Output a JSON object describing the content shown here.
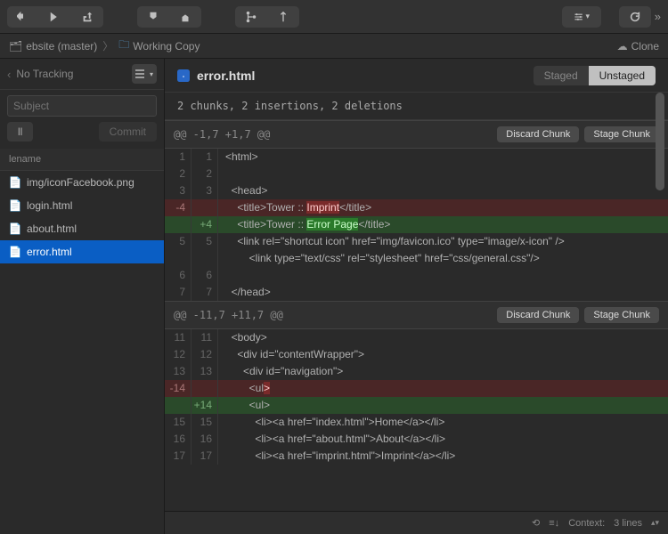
{
  "breadcrumb": {
    "repo": "ebsite (master)",
    "folder": "Working Copy"
  },
  "cloneLabel": "Clone",
  "sidebar": {
    "trackingLabel": "No Tracking",
    "subjectPlaceholder": "Subject",
    "allLabel": "ll",
    "commitLabel": "Commit",
    "columnHeader": "lename",
    "files": [
      {
        "name": "img/iconFacebook.png"
      },
      {
        "name": "login.html"
      },
      {
        "name": "about.html"
      },
      {
        "name": "error.html"
      }
    ]
  },
  "diff": {
    "filename": "error.html",
    "stagedLabel": "Staged",
    "unstagedLabel": "Unstaged",
    "summary": "2 chunks, 2 insertions, 2 deletions",
    "discardLabel": "Discard Chunk",
    "stageLabel": "Stage Chunk",
    "chunks": [
      {
        "range": "@@ -1,7 +1,7 @@",
        "lines": [
          {
            "old": "1",
            "new": "1",
            "type": "ctx",
            "text": "<html>"
          },
          {
            "old": "2",
            "new": "2",
            "type": "ctx",
            "text": ""
          },
          {
            "old": "3",
            "new": "3",
            "type": "ctx",
            "text": "  <head>"
          },
          {
            "old": "-4",
            "new": "",
            "type": "del",
            "prefix": "    <title>Tower :: ",
            "highlight": "Imprint",
            "suffix": "</title>"
          },
          {
            "old": "",
            "new": "+4",
            "type": "add",
            "prefix": "    <title>Tower :: ",
            "highlight": "Error Page",
            "suffix": "</title>"
          },
          {
            "old": "5",
            "new": "5",
            "type": "ctx",
            "text": "    <link rel=\"shortcut icon\" href=\"img/favicon.ico\" type=\"image/x-icon\" />"
          },
          {
            "old": "",
            "new": "",
            "type": "ctx",
            "text": "        <link type=\"text/css\" rel=\"stylesheet\" href=\"css/general.css\"/>"
          },
          {
            "old": "6",
            "new": "6",
            "type": "ctx",
            "text": ""
          },
          {
            "old": "7",
            "new": "7",
            "type": "ctx",
            "text": "  </head>"
          }
        ]
      },
      {
        "range": "@@ -11,7 +11,7 @@",
        "lines": [
          {
            "old": "11",
            "new": "11",
            "type": "ctx",
            "text": "  <body>"
          },
          {
            "old": "12",
            "new": "12",
            "type": "ctx",
            "text": "    <div id=\"contentWrapper\">"
          },
          {
            "old": "13",
            "new": "13",
            "type": "ctx",
            "text": "      <div id=\"navigation\">"
          },
          {
            "old": "-14",
            "new": "",
            "type": "del",
            "prefix": "        <ul",
            "highlight": ">",
            "suffix": ""
          },
          {
            "old": "",
            "new": "+14",
            "type": "add",
            "prefix": "        <ul>",
            "highlight": "",
            "suffix": ""
          },
          {
            "old": "15",
            "new": "15",
            "type": "ctx",
            "text": "          <li><a href=\"index.html\">Home</a></li>"
          },
          {
            "old": "16",
            "new": "16",
            "type": "ctx",
            "text": "          <li><a href=\"about.html\">About</a></li>"
          },
          {
            "old": "17",
            "new": "17",
            "type": "ctx",
            "text": "          <li><a href=\"imprint.html\">Imprint</a></li>"
          }
        ]
      }
    ]
  },
  "statusbar": {
    "contextLabel": "Context:",
    "contextValue": "3 lines"
  }
}
